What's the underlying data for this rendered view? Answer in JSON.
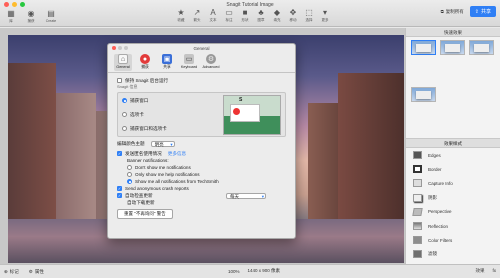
{
  "window": {
    "title": "Snagit Tutorial Image"
  },
  "toolbar": {
    "left": [
      {
        "icon": "library-icon",
        "label": "库"
      },
      {
        "icon": "capture-icon",
        "label": "捕获"
      },
      {
        "icon": "create-icon",
        "label": "Create"
      }
    ],
    "center": [
      {
        "icon": "star-icon",
        "label": "收藏"
      },
      {
        "icon": "arrow-icon",
        "label": "箭头"
      },
      {
        "icon": "text-icon",
        "label": "文本"
      },
      {
        "icon": "callout-icon",
        "label": "标注"
      },
      {
        "icon": "shape-icon",
        "label": "形状"
      },
      {
        "icon": "stamp-icon",
        "label": "图章"
      },
      {
        "icon": "fill-icon",
        "label": "填充"
      },
      {
        "icon": "move-icon",
        "label": "移动"
      },
      {
        "icon": "select-icon",
        "label": "选择"
      },
      {
        "icon": "more-icon",
        "label": "更多"
      }
    ],
    "copy_all": "复制所有",
    "share": "共享"
  },
  "dialog": {
    "title": "General",
    "tabs": [
      {
        "label": "General",
        "color": "#f0f0f0",
        "glyph": "⌂"
      },
      {
        "label": "捕获",
        "color": "#e23b3b",
        "glyph": "●"
      },
      {
        "label": "共享",
        "color": "#3a6fd8",
        "glyph": "▣"
      },
      {
        "label": "Keyboard",
        "color": "#b9b9b9",
        "glyph": "▭"
      },
      {
        "label": "Advanced",
        "color": "#8a8a8a",
        "glyph": "⚙"
      }
    ],
    "background_run": "保持 Snagit 后台运行",
    "snagit_info": "Snagit 信息",
    "radio_options": [
      "捕获窗口",
      "选项卡",
      "捕获窗口和选项卡"
    ],
    "theme_label": "编辑颜色主题",
    "theme_value": "明亮",
    "send_usage": "发送匿名使用情况",
    "learn_more": "更多信息",
    "banner_heading": "Banner notifications:",
    "banner_options": [
      "Don't show me notifications",
      "Only show me help notifications",
      "Show me all notifications from TechSmith"
    ],
    "send_crash": "Send anonymous crash reports",
    "auto_update": "自动检查更新",
    "update_frequency": "每天",
    "auto_download": "自动下载更新",
    "reset_button": "重置 \"不再询问\" 警告"
  },
  "sidebar": {
    "presets_title": "快速效果",
    "effects_title": "效果样式",
    "effects": [
      {
        "label": "Edges"
      },
      {
        "label": "Border"
      },
      {
        "label": "Capture Info"
      },
      {
        "label": "阴影"
      },
      {
        "label": "Perspective"
      },
      {
        "label": "Reflection"
      },
      {
        "label": "Color Filters"
      },
      {
        "label": "滤镜"
      }
    ]
  },
  "status": {
    "tag": "标记",
    "properties": "属性",
    "zoom": "100%",
    "dimensions": "1440 x 900 像素",
    "effects": "效果",
    "fx": "fx"
  }
}
